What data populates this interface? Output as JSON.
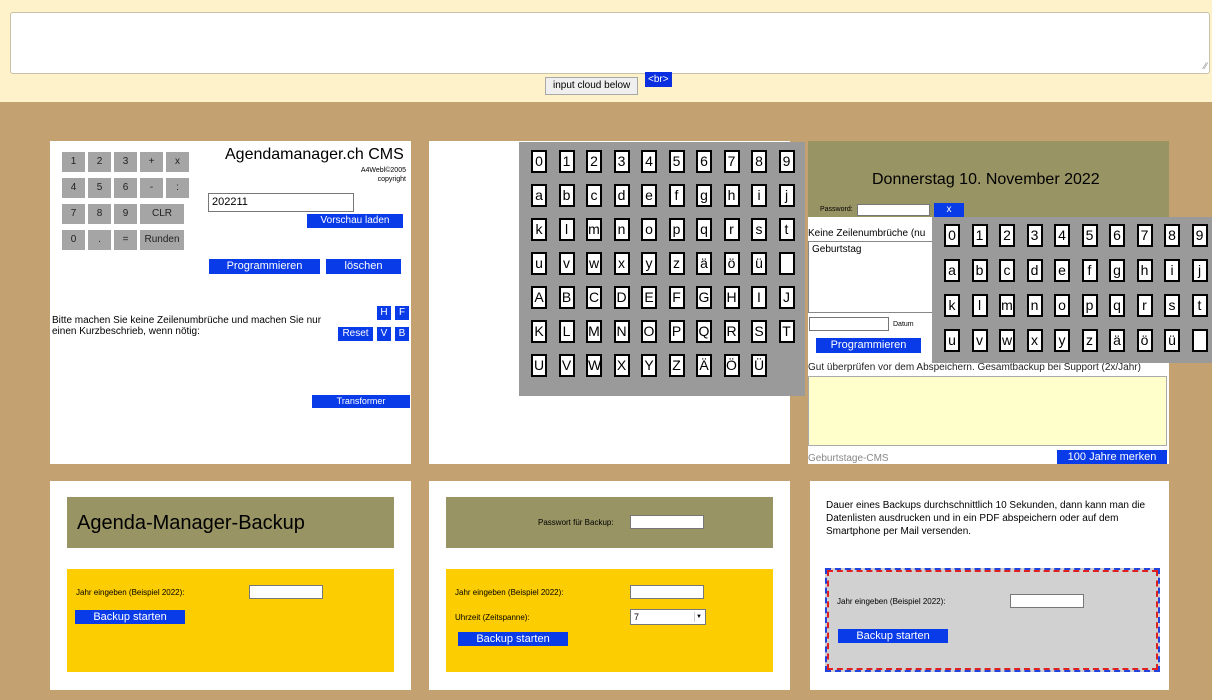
{
  "top": {
    "cloud_button": "input cloud below",
    "br_button": "<br>",
    "resize_glyph": "⁄⁄"
  },
  "cms": {
    "calc_keys": [
      [
        "1",
        "2",
        "3",
        "+",
        "x"
      ],
      [
        "4",
        "5",
        "6",
        "-",
        ":"
      ],
      [
        "7",
        "8",
        "9",
        "CLR"
      ],
      [
        "0",
        ".",
        "=",
        "Runden"
      ]
    ],
    "title": "Agendamanager.ch CMS",
    "credit1": "A4Webl©2005",
    "credit2": "copyright",
    "date_value": "202211",
    "preview_button": "Vorschau laden",
    "program_button": "Programmieren",
    "delete_button": "löschen",
    "instruction": "Bitte machen Sie keine Zeilenumbrüche und machen Sie nur einen Kurzbeschrieb, wenn nötig:",
    "h_button": "H",
    "f_button": "F",
    "reset_button": "Reset",
    "v_button": "V",
    "b_button": "B",
    "transform_button": "Transformer"
  },
  "keyboard_large": {
    "rows": [
      [
        "0",
        "1",
        "2",
        "3",
        "4",
        "5",
        "6",
        "7",
        "8",
        "9"
      ],
      [
        "a",
        "b",
        "c",
        "d",
        "e",
        "f",
        "g",
        "h",
        "i",
        "j"
      ],
      [
        "k",
        "l",
        "m",
        "n",
        "o",
        "p",
        "q",
        "r",
        "s",
        "t"
      ],
      [
        "u",
        "v",
        "w",
        "x",
        "y",
        "z",
        "ä",
        "ö",
        "ü",
        " "
      ],
      [
        "A",
        "B",
        "C",
        "D",
        "E",
        "F",
        "G",
        "H",
        "I",
        "J"
      ],
      [
        "K",
        "L",
        "M",
        "N",
        "O",
        "P",
        "Q",
        "R",
        "S",
        "T"
      ],
      [
        "U",
        "V",
        "W",
        "X",
        "Y",
        "Z",
        "Ä",
        "Ö",
        "Ü"
      ]
    ]
  },
  "birthday": {
    "date_header": "Donnerstag 10. November 2022",
    "password_label": "Password:",
    "x_button": "x",
    "hint": "Keine Zeilenumbrüche (nu",
    "textarea_value": "Geburtstag",
    "datum_label": "Datum",
    "program_button": "Programmieren",
    "warning": "Gut überprüfen vor dem Abspeichern. Gesamtbackup bei Support (2x/Jahr)",
    "footer_label": "Geburtstage-CMS",
    "footer_button": "100 Jahre merken"
  },
  "keyboard_small": {
    "rows": [
      [
        "0",
        "1",
        "2",
        "3",
        "4",
        "5",
        "6",
        "7",
        "8",
        "9"
      ],
      [
        "a",
        "b",
        "c",
        "d",
        "e",
        "f",
        "g",
        "h",
        "i",
        "j"
      ],
      [
        "k",
        "l",
        "m",
        "n",
        "o",
        "p",
        "q",
        "r",
        "s",
        "t"
      ],
      [
        "u",
        "v",
        "w",
        "x",
        "y",
        "z",
        "ä",
        "ö",
        "ü",
        " "
      ]
    ]
  },
  "backup1": {
    "title": "Agenda-Manager-Backup",
    "year_label": "Jahr eingeben (Beispiel 2022):",
    "start_button": "Backup starten"
  },
  "backup2": {
    "password_label": "Passwort für Backup:",
    "year_label": "Jahr eingeben (Beispiel 2022):",
    "time_label": "Uhrzeit  (Zeitspanne):",
    "time_value": "7",
    "start_button": "Backup starten"
  },
  "backup3": {
    "description": "Dauer eines Backups durchschnittlich 10 Sekunden, dann kann man die Datenlisten ausdrucken und in ein PDF abspeichern oder auf dem Smartphone per Mail versenden.",
    "year_label": "Jahr eingeben (Beispiel 2022):",
    "start_button": "Backup starten"
  },
  "colors": {
    "background": "#c4a170",
    "button_blue": "#0a3be8",
    "olive": "#989464",
    "yellow": "#fccd00",
    "keyboard_gray": "#9a9a9a"
  }
}
